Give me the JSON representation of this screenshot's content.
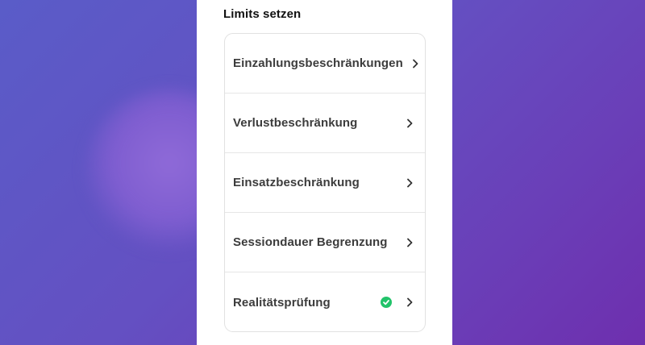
{
  "limits": {
    "title": "Limits setzen",
    "items": [
      {
        "label": "Einzahlungsbeschränkungen",
        "icon": "chevron-right-icon"
      },
      {
        "label": "Verlustbeschränkung",
        "icon": "chevron-right-icon"
      },
      {
        "label": "Einsatzbeschränkung",
        "icon": "chevron-right-icon"
      },
      {
        "label": "Sessiondauer Begrenzung",
        "icon": "chevron-right-icon"
      },
      {
        "label": "Realitätsprüfung",
        "icon": "chevron-right-icon",
        "status_icon": "check-circle-icon",
        "status_color": "#22c36a"
      }
    ]
  },
  "colors": {
    "background_start": "#5a5cc8",
    "background_end": "#6e2fae",
    "panel": "#ffffff",
    "text": "#3c3c3c"
  }
}
